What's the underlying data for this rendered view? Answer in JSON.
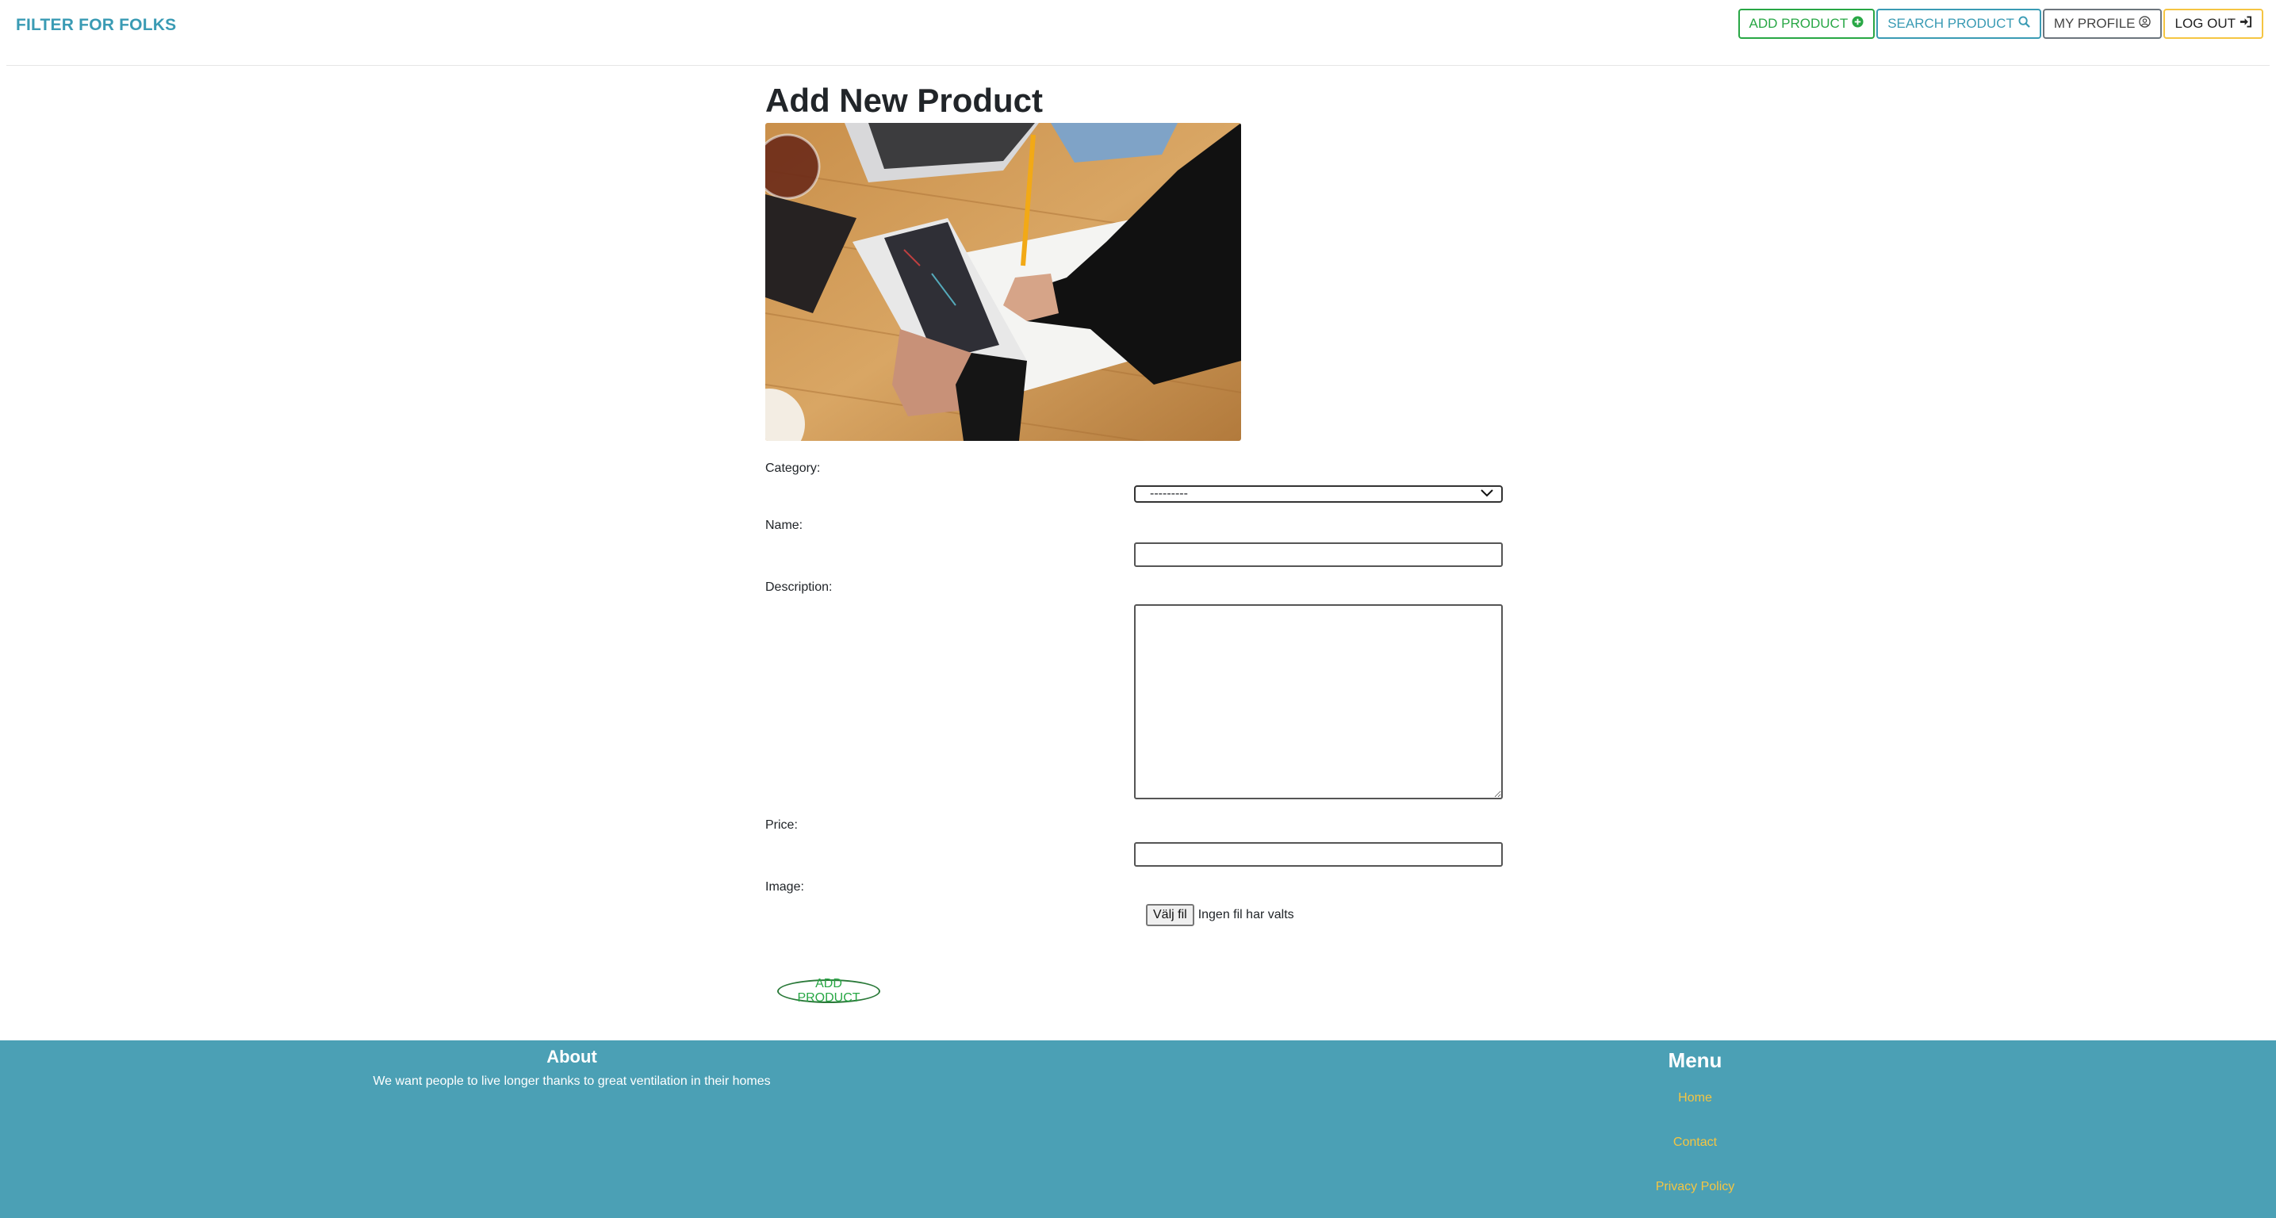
{
  "header": {
    "brand": "FILTER FOR FOLKS",
    "buttons": {
      "add_product": "ADD PRODUCT",
      "search_product": "SEARCH PRODUCT",
      "my_profile": "MY PROFILE",
      "log_out": "LOG OUT"
    },
    "icons": {
      "add_product": "plus-circle-icon",
      "search_product": "search-icon",
      "my_profile": "user-circle-icon",
      "log_out": "sign-in-icon"
    }
  },
  "main": {
    "title": "Add New Product",
    "form": {
      "category_label": "Category:",
      "category_value": "---------",
      "name_label": "Name:",
      "name_value": "",
      "description_label": "Description:",
      "description_value": "",
      "price_label": "Price:",
      "price_value": "",
      "image_label": "Image:",
      "file_button": "Välj fil",
      "file_status": "Ingen fil har valts",
      "submit": "ADD PRODUCT"
    }
  },
  "footer": {
    "about_title": "About",
    "about_text": "We want people to live longer thanks to great ventilation in their homes",
    "menu_title": "Menu",
    "links": [
      "Home",
      "Contact",
      "Privacy Policy"
    ]
  },
  "colors": {
    "brand": "#3a9bb4",
    "footer_bg": "#4ba0b5",
    "link": "#f5c542",
    "green": "#28a745"
  }
}
